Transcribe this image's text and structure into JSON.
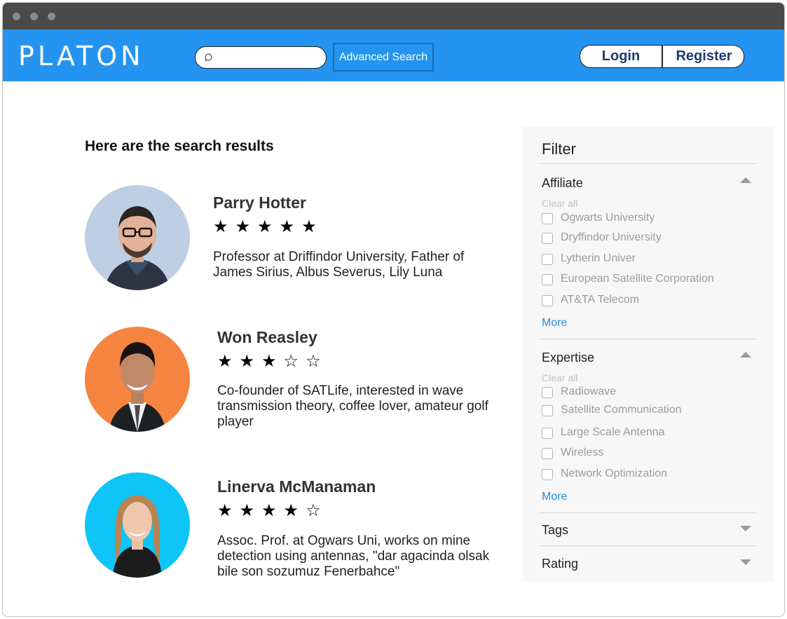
{
  "header": {
    "logo": "PLATON",
    "search_placeholder": "",
    "advanced_search_label": "Advanced Search",
    "login_label": "Login",
    "register_label": "Register"
  },
  "main": {
    "results_title": "Here are the search results",
    "results": [
      {
        "name": "Parry Hotter",
        "rating": 5,
        "stars": "★★★★★",
        "description": "Professor at Driffindor University, Father of James Sirius, Albus Severus, Lily Luna",
        "avatar_bg": "#bfcfe3"
      },
      {
        "name": "Won Reasley",
        "rating": 3,
        "stars": "★★★☆☆",
        "description": "Co-founder of SATLife, interested in wave transmission theory, coffee lover, amateur golf player",
        "avatar_bg": "#f58440"
      },
      {
        "name": "Linerva McManaman",
        "rating": 4,
        "stars": "★★★★☆",
        "description": "Assoc. Prof. at Ogwars Uni, works on mine detection using antennas, \"dar agacinda olsak bile son sozumuz Fenerbahce\"",
        "avatar_bg": "#0fc4f7"
      }
    ]
  },
  "filter": {
    "title": "Filter",
    "sections": {
      "affiliate": {
        "label": "Affiliate",
        "clear_all": "Clear all",
        "options": [
          "Ogwarts University",
          "Dryffindor University",
          "Lytherin Univer",
          "European Satellite Corporation",
          "AT&TA Telecom"
        ],
        "more": "More",
        "expanded": true
      },
      "expertise": {
        "label": "Expertise",
        "clear_all": "Clear all",
        "options": [
          "Radiowave",
          "Satellite Communication",
          "Large Scale Antenna",
          "Wireless",
          "Network Optimization"
        ],
        "more": "More",
        "expanded": true
      },
      "tags": {
        "label": "Tags",
        "expanded": false
      },
      "rating": {
        "label": "Rating",
        "expanded": false
      }
    }
  },
  "colors": {
    "nav_bg": "#2494f0",
    "titlebar_bg": "#4a4a4a",
    "link": "#2a8bd8",
    "auth_text": "#1e3a6e"
  }
}
